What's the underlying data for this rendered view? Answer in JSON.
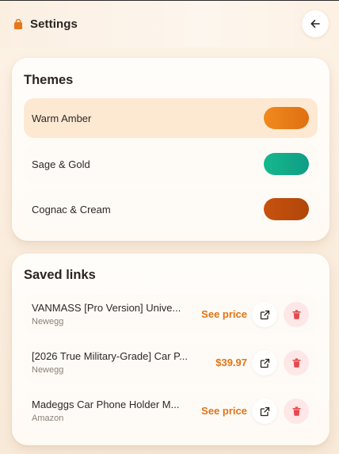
{
  "header": {
    "title": "Settings",
    "brand_icon": "shopping-bag-icon",
    "back_icon": "arrow-left-icon",
    "accent": "#e8761a"
  },
  "themes": {
    "title": "Themes",
    "items": [
      {
        "name": "Warm Amber",
        "selected": true,
        "swatch_colors": [
          "#f08a1e",
          "#e06f12"
        ]
      },
      {
        "name": "Sage & Gold",
        "selected": false,
        "swatch_colors": [
          "#16b88c",
          "#0f9d86"
        ]
      },
      {
        "name": "Cognac & Cream",
        "selected": false,
        "swatch_colors": [
          "#c8520e",
          "#b0460a"
        ]
      }
    ]
  },
  "saved_links": {
    "title": "Saved links",
    "open_icon": "external-link-icon",
    "delete_icon": "trash-icon",
    "price_color": "#e07418",
    "delete_color": "#e5484d",
    "items": [
      {
        "title": "VANMASS [Pro Version] Unive...",
        "source": "Newegg",
        "price": "See price"
      },
      {
        "title": "[2026 True Military-Grade] Car P...",
        "source": "Newegg",
        "price": "$39.97"
      },
      {
        "title": "Madeggs Car Phone Holder M...",
        "source": "Amazon",
        "price": "See price"
      }
    ]
  }
}
